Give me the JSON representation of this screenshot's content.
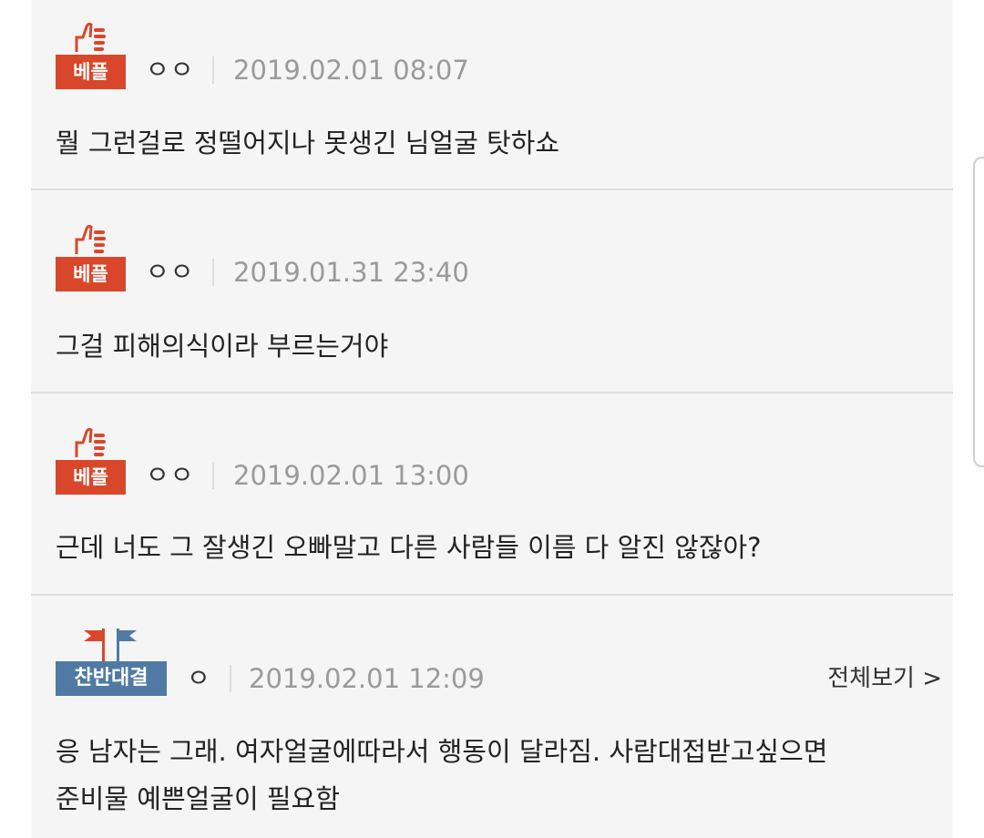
{
  "comments": [
    {
      "badge": "베플",
      "nickname": "ㅇㅇ",
      "timestamp": "2019.02.01 08:07",
      "text": "뭘 그런걸로 정떨어지나 못생긴 님얼굴 탓하쇼"
    },
    {
      "badge": "베플",
      "nickname": "ㅇㅇ",
      "timestamp": "2019.01.31 23:40",
      "text": "그걸 피해의식이라 부르는거야"
    },
    {
      "badge": "베플",
      "nickname": "ㅇㅇ",
      "timestamp": "2019.02.01 13:00",
      "text": "근데 너도 그 잘생긴 오빠말고 다른 사람들 이름 다 알진 않잖아?"
    },
    {
      "badge": "찬반대결",
      "nickname": "ㅇ",
      "timestamp": "2019.02.01 12:09",
      "view_all": "전체보기 >",
      "text_line1": "응 남자는 그래. 여자얼굴에따라서 행동이 달라짐. 사람대접받고싶으면",
      "text_line2": "준비물 예쁜얼굴이 필요함"
    }
  ],
  "colors": {
    "best_badge": "#d9472b",
    "debate_badge": "#4f7aa3",
    "background": "#f5f5f5",
    "meta_text": "#9a9a9a"
  },
  "icons": {
    "best": "thumbs-up-icon",
    "debate": "flags-icon"
  }
}
